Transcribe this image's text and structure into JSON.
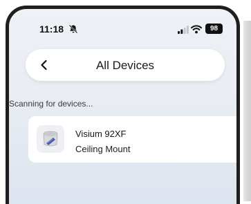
{
  "status_bar": {
    "time": "11:18",
    "battery": "98"
  },
  "header": {
    "title": "All Devices"
  },
  "scan": {
    "status": "Scanning for devices..."
  },
  "devices": [
    {
      "name": "Visium 92XF",
      "type": "Ceiling Mount"
    }
  ]
}
